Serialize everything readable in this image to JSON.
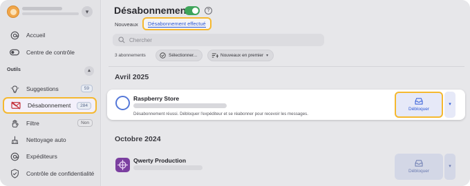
{
  "sidebar": {
    "items_top": [
      {
        "label": "Accueil",
        "icon": "at-sign-icon"
      },
      {
        "label": "Centre de contrôle",
        "icon": "toggle-icon"
      }
    ],
    "section_label": "Outils",
    "tools": [
      {
        "label": "Suggestions",
        "icon": "lightbulb-icon",
        "badge": "59"
      },
      {
        "label": "Désabonnement",
        "icon": "mail-off-icon",
        "badge": "284"
      },
      {
        "label": "Filtre",
        "icon": "hand-icon",
        "badge": "Non"
      },
      {
        "label": "Nettoyage auto",
        "icon": "broom-icon"
      },
      {
        "label": "Expéditeurs",
        "icon": "at-sign-icon"
      },
      {
        "label": "Contrôle de confidentialité",
        "icon": "shield-check-icon"
      }
    ]
  },
  "header": {
    "title": "Désabonnement",
    "help_glyph": "?"
  },
  "tabs": {
    "new": "Nouveaux",
    "done": "Désabonnement effectué"
  },
  "search": {
    "placeholder": "Chercher"
  },
  "toolbar": {
    "count": "3 abonnements",
    "select_label": "Sélectionner...",
    "sort_label": "Nouveaux en premier"
  },
  "groups": [
    {
      "month": "Avril 2025",
      "items": [
        {
          "name": "Raspberry Store",
          "message": "Désabonnement réussi. Débloquer l'expéditeur et se réabonner pour recevoir les messages.",
          "action": "Débloquer"
        }
      ]
    },
    {
      "month": "Octobre 2024",
      "items": [
        {
          "name": "Qwerty Production",
          "action": "Débloquer"
        }
      ]
    }
  ],
  "colors": {
    "accent": "#2c58d6",
    "highlight": "#f5b82e",
    "toggle_on": "#3ea45a",
    "qwerty_logo": "#7b3fa0"
  }
}
